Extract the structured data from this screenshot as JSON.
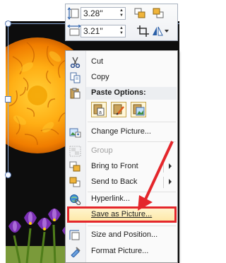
{
  "mini_toolbar": {
    "height_value": "3.28\"",
    "width_value": "3.21\""
  },
  "context_menu": {
    "items": [
      {
        "label": "Cut",
        "enabled": true
      },
      {
        "label": "Copy",
        "enabled": true
      },
      {
        "label": "Paste Options:",
        "enabled": true
      },
      {
        "label": "Change Picture...",
        "enabled": true
      },
      {
        "label": "Group",
        "enabled": false
      },
      {
        "label": "Bring to Front",
        "enabled": true,
        "submenu": true
      },
      {
        "label": "Send to Back",
        "enabled": true,
        "submenu": true
      },
      {
        "label": "Hyperlink...",
        "enabled": true
      },
      {
        "label": "Save as Picture...",
        "enabled": true,
        "highlighted": true
      },
      {
        "label": "Size and Position...",
        "enabled": true
      },
      {
        "label": "Format Picture...",
        "enabled": true
      }
    ]
  },
  "colors": {
    "highlight_outline": "#e4262b",
    "arrow": "#e4262b",
    "menu_hover": "#fde7a5"
  },
  "icons": [
    "scissors-icon",
    "copy-icon",
    "paste-icon",
    "paste-keep-format-icon",
    "paste-picture-icon",
    "paste-image-icon",
    "change-picture-icon",
    "group-icon",
    "bring-to-front-icon",
    "send-to-back-icon",
    "hyperlink-icon",
    "save-picture-icon",
    "size-position-icon",
    "format-picture-icon"
  ]
}
